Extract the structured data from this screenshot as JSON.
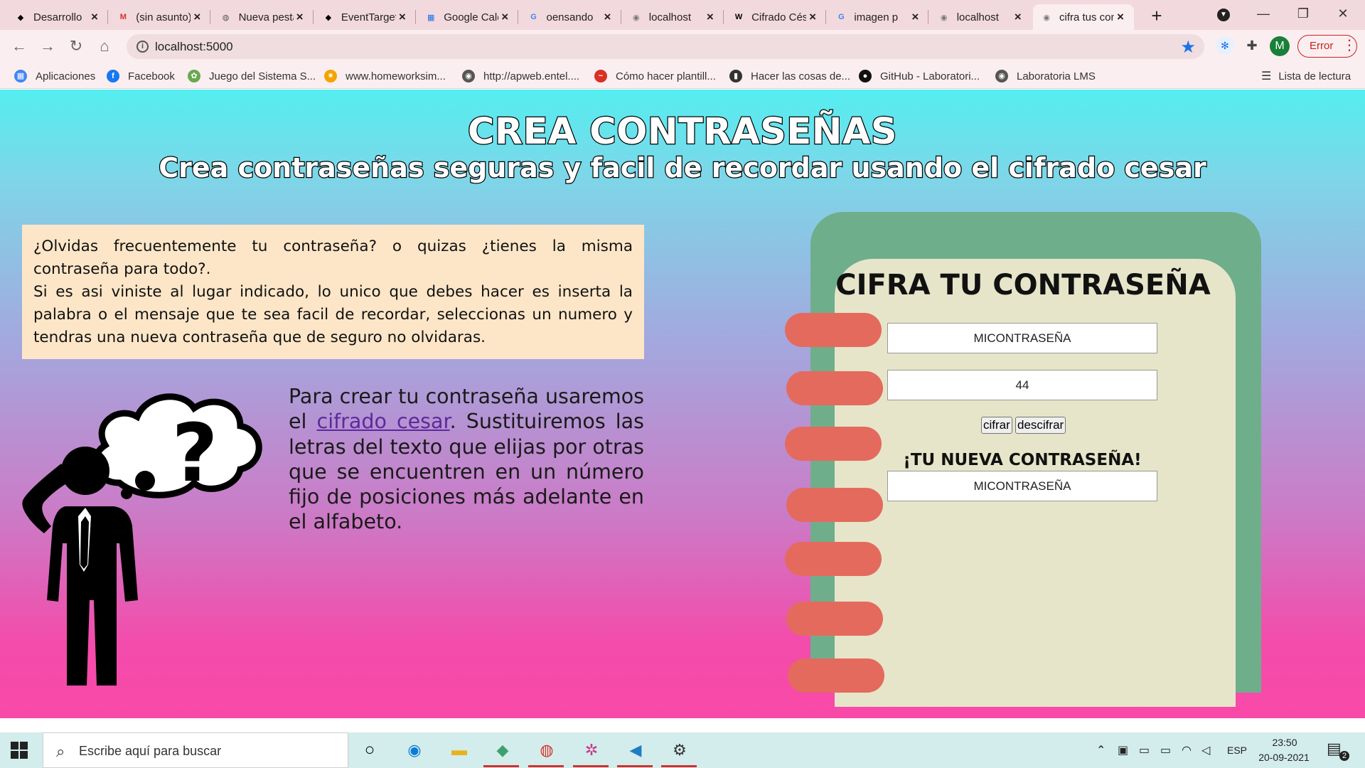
{
  "browser": {
    "tabs": [
      {
        "label": "Desarrollo",
        "favicon": "laboratoria-icon",
        "color": "#000000"
      },
      {
        "label": "(sin asunto)",
        "favicon": "gmail-icon",
        "color": "#d93025"
      },
      {
        "label": "Nueva pestaña",
        "favicon": "chrome-icon",
        "color": "#555555"
      },
      {
        "label": "EventTarget",
        "favicon": "laboratoria-icon",
        "color": "#000000"
      },
      {
        "label": "Google Calendar",
        "favicon": "calendar-icon",
        "color": "#1a73e8"
      },
      {
        "label": "oensando",
        "favicon": "google-icon",
        "color": "#4285f4"
      },
      {
        "label": "localhost",
        "favicon": "globe-icon",
        "color": "#777777"
      },
      {
        "label": "Cifrado César",
        "favicon": "wikipedia-icon",
        "color": "#000000"
      },
      {
        "label": "imagen p",
        "favicon": "google-icon",
        "color": "#4285f4"
      },
      {
        "label": "localhost",
        "favicon": "globe-icon",
        "color": "#777777"
      },
      {
        "label": "cifra tus contraseñas",
        "favicon": "globe-icon",
        "color": "#777777"
      }
    ],
    "new_tab_symbol": "+",
    "url": "localhost:5000",
    "error_label": "Error",
    "profile_initial": "M",
    "bookmarks": [
      {
        "label": "Aplicaciones",
        "icon": "apps-grid-icon",
        "color": "#4285f4"
      },
      {
        "label": "Facebook",
        "icon": "facebook-icon",
        "color": "#1877f2"
      },
      {
        "label": "Juego del Sistema S...",
        "icon": "game-icon",
        "color": "#6aa84f"
      },
      {
        "label": "www.homeworksim...",
        "icon": "sun-icon",
        "color": "#f4a300"
      },
      {
        "label": "http://apweb.entel....",
        "icon": "globe-icon",
        "color": "#555555"
      },
      {
        "label": "Cómo hacer plantill...",
        "icon": "chart-icon",
        "color": "#d93025"
      },
      {
        "label": "Hacer las cosas de...",
        "icon": "book-icon",
        "color": "#333333"
      },
      {
        "label": "GitHub - Laboratori...",
        "icon": "github-icon",
        "color": "#111111"
      },
      {
        "label": "Laboratoria LMS",
        "icon": "globe-icon",
        "color": "#555555"
      }
    ],
    "reading_list": "Lista de lectura"
  },
  "page": {
    "title": "CREA CONTRASEÑAS",
    "subtitle": "Crea contraseñas seguras y facil de recordar usando el cifrado cesar",
    "intro_q": "¿Olvidas frecuentemente tu contraseña? o quizas ¿tienes la misma contraseña para todo?.",
    "intro_body": "Si es asi viniste al lugar indicado, lo unico que debes hacer es inserta la palabra o el mensaje que te sea facil de recordar, seleccionas un numero y tendras una nueva contraseña que de seguro no olvidaras.",
    "explain_before": "Para crear tu contraseña usaremos el ",
    "explain_link": "cifrado cesar",
    "explain_after": ". Sustituiremos las letras del texto que elijas por otras que se encuentren en un número fijo de posiciones más adelante en el alfabeto.",
    "panel_title": "CIFRA TU CONTRASEÑA",
    "message_value": "MICONTRASEÑA",
    "offset_value": "44",
    "cipher_button": "cifrar",
    "decipher_button": "descifrar",
    "result_label": "¡TU NUEVA CONTRASEÑA!",
    "result_value": "MICONTRASEÑA",
    "colors": {
      "notebook_back": "#6fae8b",
      "notebook_page": "#e6e5c9",
      "rings": "#e46a5e",
      "intro_box": "#fde6c8",
      "link": "#5b2a9b"
    }
  },
  "taskbar": {
    "search_placeholder": "Escribe aquí para buscar",
    "apps": [
      "cortana-icon",
      "edge-icon",
      "file-explorer-icon",
      "gitkraken-icon",
      "chrome-icon",
      "slack-icon",
      "vscode-icon",
      "settings-icon"
    ],
    "language": "ESP",
    "time": "23:50",
    "date": "20-09-2021",
    "notifications": "2"
  }
}
